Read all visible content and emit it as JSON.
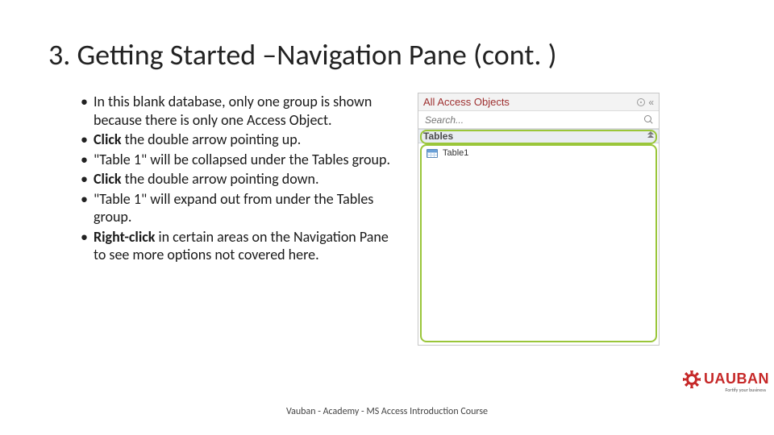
{
  "title": "3. Getting Started –Navigation Pane (cont. )",
  "bullets": [
    {
      "pre": "",
      "bold": "",
      "post": "In this blank database, only one group is shown because there is only one Access Object."
    },
    {
      "pre": "",
      "bold": "Click",
      "post": " the double arrow pointing up."
    },
    {
      "pre": "\"Table 1\" will be collapsed under the Tables group.",
      "bold": "",
      "post": ""
    },
    {
      "pre": "",
      "bold": "Click",
      "post": " the double arrow pointing down."
    },
    {
      "pre": "\"Table 1\" will expand out from under the Tables group.",
      "bold": "",
      "post": ""
    },
    {
      "pre": "",
      "bold": "Right-click",
      "post": " in certain areas on the Navigation Pane to see more options not covered here."
    }
  ],
  "navpane": {
    "header": "All Access Objects",
    "search_placeholder": "Search...",
    "group": "Tables",
    "item": "Table1",
    "collapse_glyph": "«"
  },
  "logo": {
    "name": "UAUBAN",
    "tagline": "Fortify your business"
  },
  "footer": "Vauban - Academy - MS Access Introduction Course"
}
